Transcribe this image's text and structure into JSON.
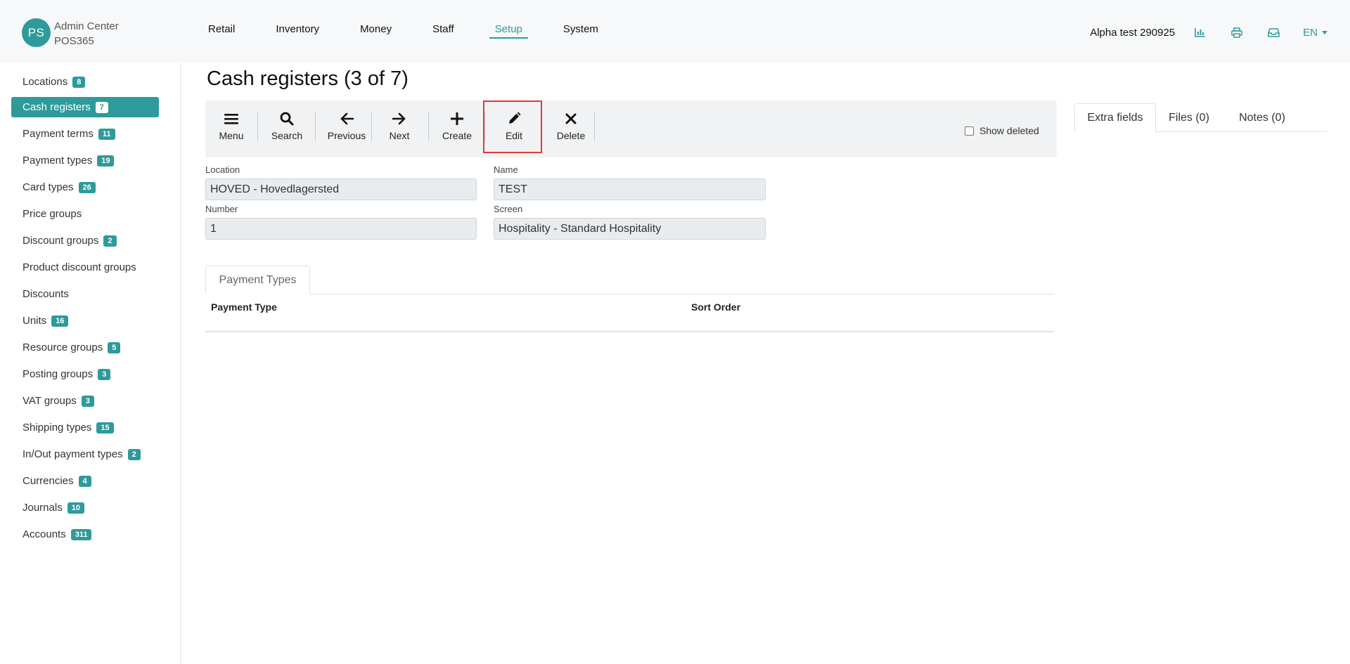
{
  "header": {
    "avatar_initials": "PS",
    "brand_line1": "Admin Center",
    "brand_line2": "POS365",
    "nav": [
      "Retail",
      "Inventory",
      "Money",
      "Staff",
      "Setup",
      "System"
    ],
    "active_nav": "Setup",
    "company": "Alpha test 290925",
    "language": "EN",
    "icons": [
      "chart-icon",
      "printer-icon",
      "inbox-icon"
    ]
  },
  "sidebar": {
    "items": [
      {
        "label": "Locations",
        "badge": "8"
      },
      {
        "label": "Cash registers",
        "badge": "7",
        "active": true
      },
      {
        "label": "Payment terms",
        "badge": "11"
      },
      {
        "label": "Payment types",
        "badge": "19"
      },
      {
        "label": "Card types",
        "badge": "26"
      },
      {
        "label": "Price groups",
        "badge": ""
      },
      {
        "label": "Discount groups",
        "badge": "2"
      },
      {
        "label": "Product discount groups",
        "badge": ""
      },
      {
        "label": "Discounts",
        "badge": ""
      },
      {
        "label": "Units",
        "badge": "16"
      },
      {
        "label": "Resource groups",
        "badge": "5"
      },
      {
        "label": "Posting groups",
        "badge": "3"
      },
      {
        "label": "VAT groups",
        "badge": "3"
      },
      {
        "label": "Shipping types",
        "badge": "15"
      },
      {
        "label": "In/Out payment types",
        "badge": "2"
      },
      {
        "label": "Currencies",
        "badge": "4"
      },
      {
        "label": "Journals",
        "badge": "10"
      },
      {
        "label": "Accounts",
        "badge": "311"
      }
    ]
  },
  "main": {
    "title": "Cash registers (3 of 7)",
    "toolbar": {
      "menu": "Menu",
      "search": "Search",
      "previous": "Previous",
      "next": "Next",
      "create": "Create",
      "edit": "Edit",
      "delete": "Delete",
      "show_deleted": "Show deleted"
    },
    "form": {
      "location_label": "Location",
      "location_value": "HOVED - Hovedlagersted",
      "name_label": "Name",
      "name_value": "TEST",
      "number_label": "Number",
      "number_value": "1",
      "screen_label": "Screen",
      "screen_value": "Hospitality - Standard Hospitality"
    },
    "payment_tab": "Payment Types",
    "table_headers": [
      "Payment Type",
      "Sort Order"
    ]
  },
  "right_tabs": {
    "extra_fields": "Extra fields",
    "files": "Files (0)",
    "notes": "Notes (0)"
  },
  "colors": {
    "accent": "#2e9a9b",
    "highlight": "#e03a3a"
  }
}
